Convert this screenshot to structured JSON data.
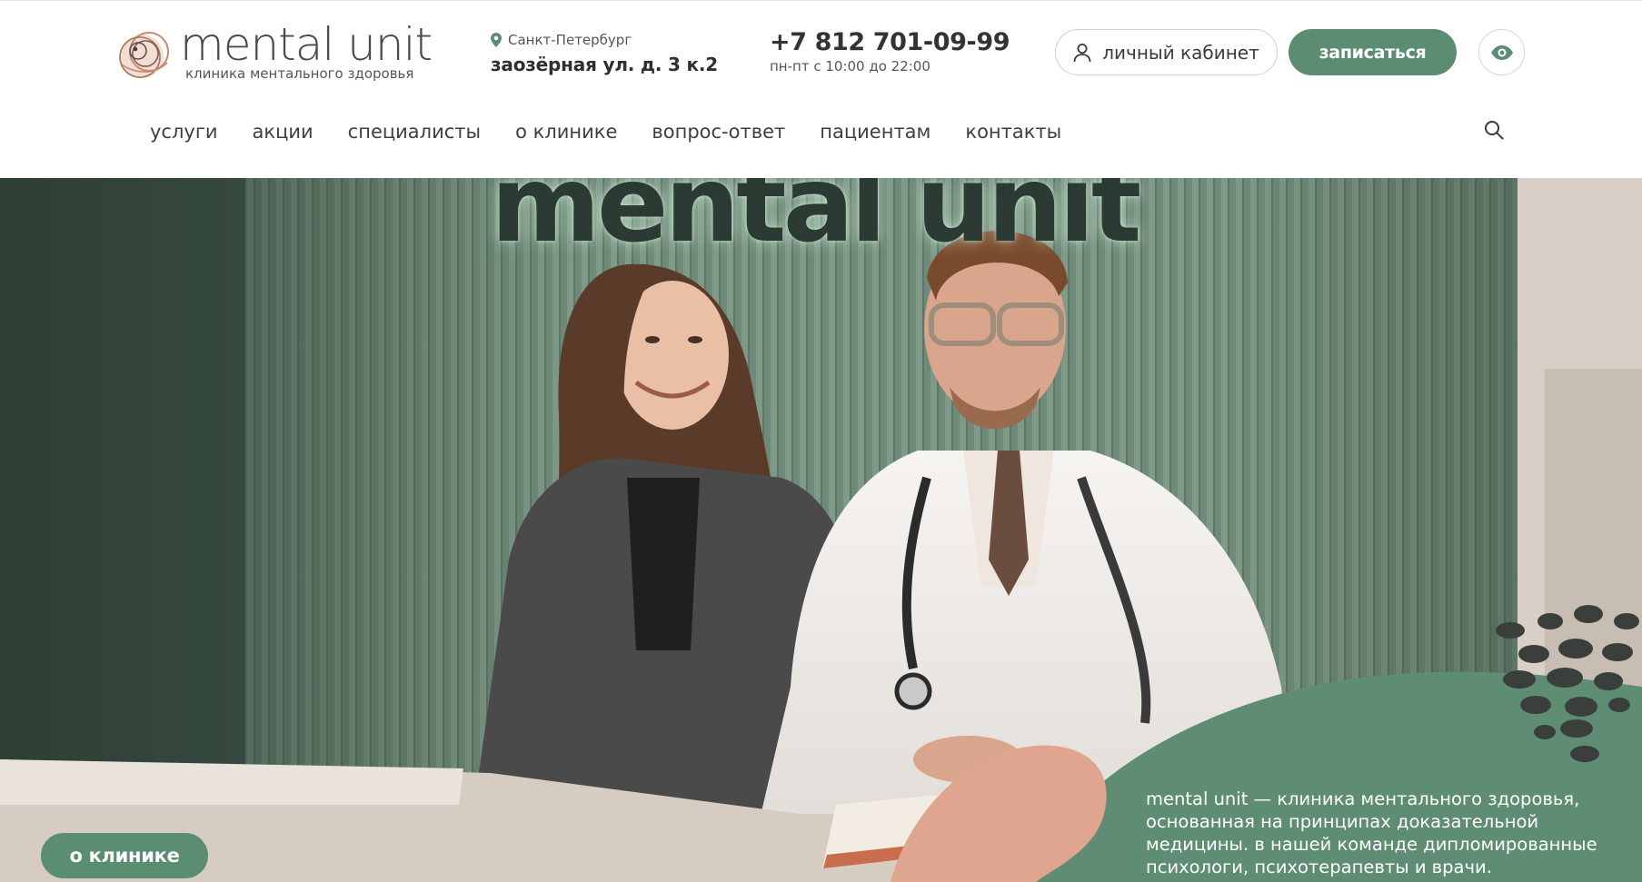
{
  "brand": {
    "name": "mental unit",
    "tagline": "клиника ментального здоровья",
    "logo_icon": "concentric-circles-logo-icon",
    "colors": {
      "accent": "#5a8d72",
      "logo_peach": "#e3a58f",
      "text_dark": "#333333"
    }
  },
  "contact": {
    "city": "Санкт-Петербург",
    "street": "заозёрная ул. д. 3 к.2",
    "phone": "+7 812 701-09-99",
    "hours": "пн-пт с 10:00 до 22:00",
    "pin_icon": "map-pin-icon"
  },
  "actions": {
    "cabinet_label": "личный кабинет",
    "cabinet_icon": "user-icon",
    "signup_label": "записаться",
    "accessibility_icon": "eye-icon"
  },
  "nav": {
    "items": [
      {
        "label": "услуги"
      },
      {
        "label": "акции"
      },
      {
        "label": "специалисты"
      },
      {
        "label": "о клинике"
      },
      {
        "label": "вопрос-ответ"
      },
      {
        "label": "пациентам"
      },
      {
        "label": "контакты"
      }
    ],
    "search_icon": "search-icon"
  },
  "hero": {
    "sign_text": "mental unit",
    "about_label": "о клинике",
    "description": "mental unit — клиника ментального здоровья, основанная на принципах доказательной медицины. в нашей команде дипломированные психологи, психотерапевты и врачи."
  }
}
